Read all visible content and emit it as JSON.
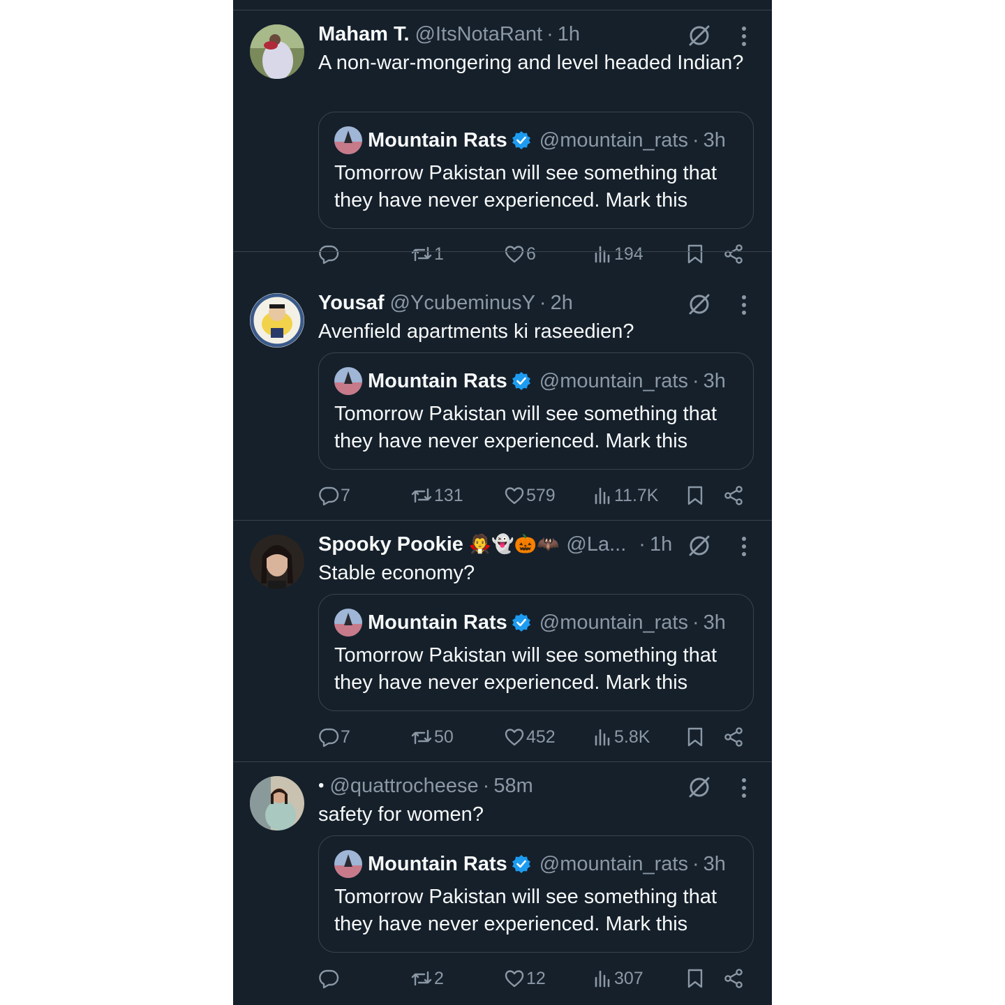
{
  "quoted_tweet": {
    "name": "Mountain Rats",
    "handle": "@mountain_rats",
    "time": "3h",
    "text": "Tomorrow Pakistan will see something that they have never experienced. Mark this"
  },
  "tweets": [
    {
      "name": "Maham T.",
      "emoji": "",
      "handle": "@ItsNotaRant",
      "time": "1h",
      "text": "A non-war-mongering and level headed Indian?",
      "stats": {
        "replies": "",
        "retweets": "1",
        "likes": "6",
        "views": "194"
      }
    },
    {
      "name": "Yousaf",
      "emoji": "",
      "handle": "@YcubeminusY",
      "time": "2h",
      "text": "Avenfield apartments ki raseedien?",
      "stats": {
        "replies": "7",
        "retweets": "131",
        "likes": "579",
        "views": "11.7K"
      }
    },
    {
      "name": "Spooky Pookie",
      "emoji": "🧛👻🎃🦇",
      "handle": "@La...",
      "time": "1h",
      "text": "Stable economy?",
      "stats": {
        "replies": "7",
        "retweets": "50",
        "likes": "452",
        "views": "5.8K"
      }
    },
    {
      "name": "",
      "bullet": "•",
      "handle": "@quattrocheese",
      "time": "58m",
      "text": "safety for women?",
      "stats": {
        "replies": "",
        "retweets": "2",
        "likes": "12",
        "views": "307"
      }
    }
  ],
  "colors": {
    "background": "#15202b",
    "text": "#f7f9f9",
    "secondary": "#8b98a5",
    "border": "#38444d",
    "verified": "#1d9bf0"
  },
  "icons": [
    "reply-icon",
    "retweet-icon",
    "like-icon",
    "views-icon",
    "bookmark-icon",
    "share-icon",
    "grok-icon",
    "more-icon",
    "verified-badge-icon"
  ]
}
